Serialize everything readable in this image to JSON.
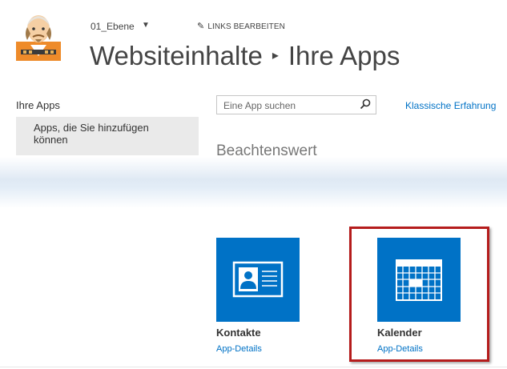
{
  "header": {
    "site_name": "01_Ebene",
    "edit_links": "LINKS BEARBEITEN",
    "title_part1": "Websiteinhalte",
    "title_separator": "▸",
    "title_part2": "Ihre Apps"
  },
  "left_nav": {
    "heading": "Ihre Apps",
    "items": [
      {
        "label": "Apps, die Sie hinzufügen können"
      }
    ]
  },
  "search": {
    "placeholder": "Eine App suchen"
  },
  "classic_link": "Klassische Erfahrung",
  "section_heading": "Beachtenswert",
  "apps": [
    {
      "name": "Kontakte",
      "details": "App-Details",
      "icon": "contact-card-icon"
    },
    {
      "name": "Kalender",
      "details": "App-Details",
      "icon": "calendar-icon"
    }
  ],
  "colors": {
    "tile_blue": "#0072c6",
    "link_blue": "#0072c6",
    "highlight_red": "#b51c1c"
  }
}
